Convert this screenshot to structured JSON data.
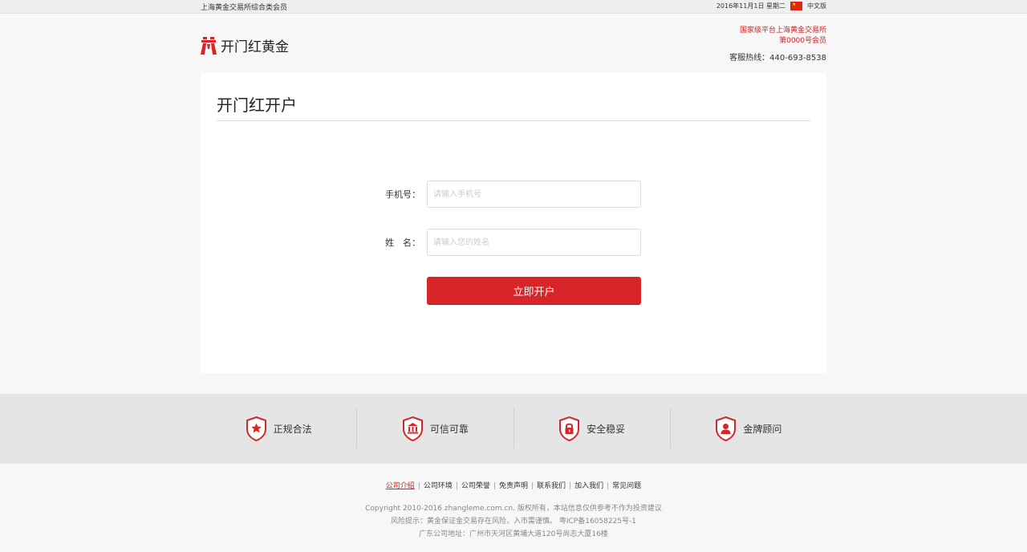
{
  "topbar": {
    "tagline": "上海黄金交易所综合类会员",
    "date": "2016年11月1日",
    "weekday": "星期二",
    "language": "中文版"
  },
  "header": {
    "logo_text": "开门红黄金",
    "platform_line1": "国家级平台上海黄金交易所",
    "platform_line2": "第0000号会员",
    "hotline": "客服热线：440-693-8538"
  },
  "form": {
    "title": "开门红开户",
    "phone_label": "手机号：",
    "phone_placeholder": "请输入手机号",
    "name_label": "姓　名：",
    "name_placeholder": "请输入您的姓名",
    "submit_label": "立即开户"
  },
  "badges": [
    {
      "label": "正规合法",
      "icon": "star-shield-icon"
    },
    {
      "label": "可信可靠",
      "icon": "bank-shield-icon"
    },
    {
      "label": "安全稳妥",
      "icon": "lock-shield-icon"
    },
    {
      "label": "金牌顾问",
      "icon": "advisor-shield-icon"
    }
  ],
  "footer": {
    "links": [
      "公司介绍",
      "公司环境",
      "公司荣誉",
      "免责声明",
      "联系我们",
      "加入我们",
      "常见问题"
    ],
    "copyright": "Copyright 2010-2016 zhangleme.com.cn. 版权所有，本站信息仅供参考不作为投资建议",
    "risk": "风险提示：黄金保证金交易存在风险，入市需谨慎。 粤ICP备16058225号-1",
    "address": "广东公司地址：广州市天河区黄埔大道120号尚志大厦16楼"
  },
  "colors": {
    "brand_red": "#d8252a",
    "text_red": "#d8201f",
    "band_grey": "#e5e5e5"
  }
}
